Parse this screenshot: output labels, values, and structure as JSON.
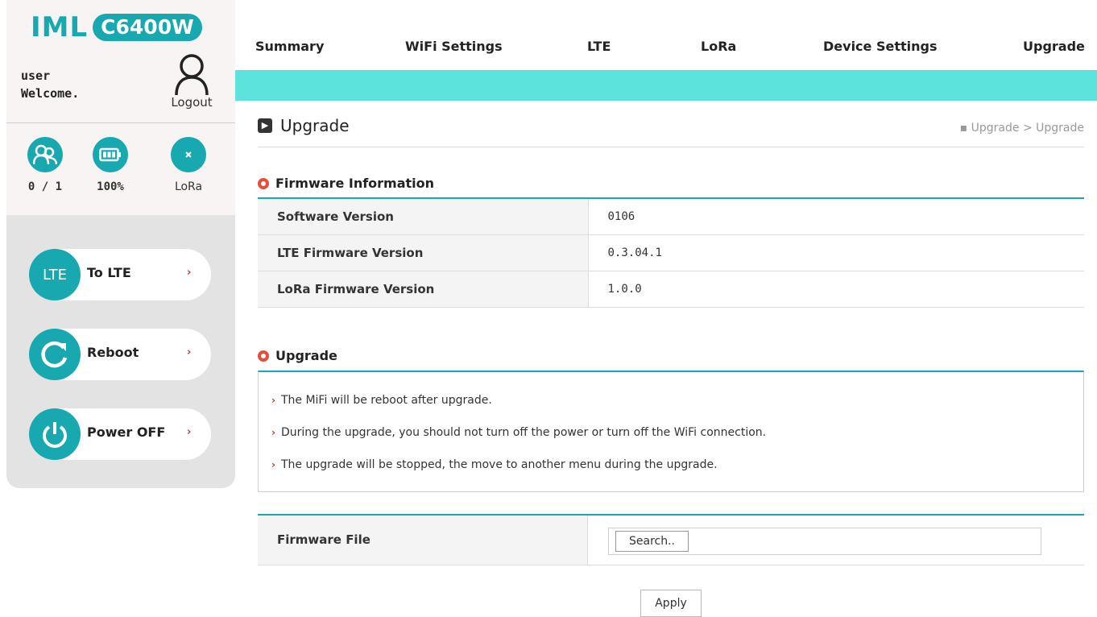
{
  "brand": {
    "logo_text": "IML",
    "model": "C6400W",
    "accent_color": "#17a8b0",
    "banner_color": "#5ce3dc"
  },
  "user": {
    "name": "user",
    "welcome": "Welcome.",
    "logout_label": "Logout"
  },
  "status": {
    "clients": {
      "icon": "users-icon",
      "value": "0 / 1"
    },
    "battery": {
      "icon": "battery-icon",
      "value": "100%"
    },
    "lora": {
      "icon": "lora-icon",
      "value": "LoRa"
    }
  },
  "side_buttons": {
    "lte": {
      "badge": "LTE",
      "label": "To LTE"
    },
    "reboot": {
      "icon": "refresh-icon",
      "label": "Reboot"
    },
    "power": {
      "icon": "power-icon",
      "label": "Power OFF"
    }
  },
  "nav": [
    "Summary",
    "WiFi Settings",
    "LTE",
    "LoRa",
    "Device Settings",
    "Upgrade"
  ],
  "page": {
    "title": "Upgrade",
    "breadcrumb": "▪ Upgrade > Upgrade"
  },
  "firmware_info": {
    "title": "Firmware Information",
    "rows": [
      {
        "label": "Software Version",
        "value": "0106"
      },
      {
        "label": "LTE Firmware Version",
        "value": "0.3.04.1"
      },
      {
        "label": "LoRa Firmware Version",
        "value": "1.0.0"
      }
    ]
  },
  "upgrade": {
    "title": "Upgrade",
    "notices": [
      "The MiFi will be reboot after upgrade.",
      "During the upgrade, you should not turn off the power or turn off the WiFi connection.",
      "The upgrade will be stopped, the move to another menu during the upgrade."
    ]
  },
  "firmware_file": {
    "label": "Firmware File",
    "search_label": "Search.."
  },
  "apply_label": "Apply"
}
